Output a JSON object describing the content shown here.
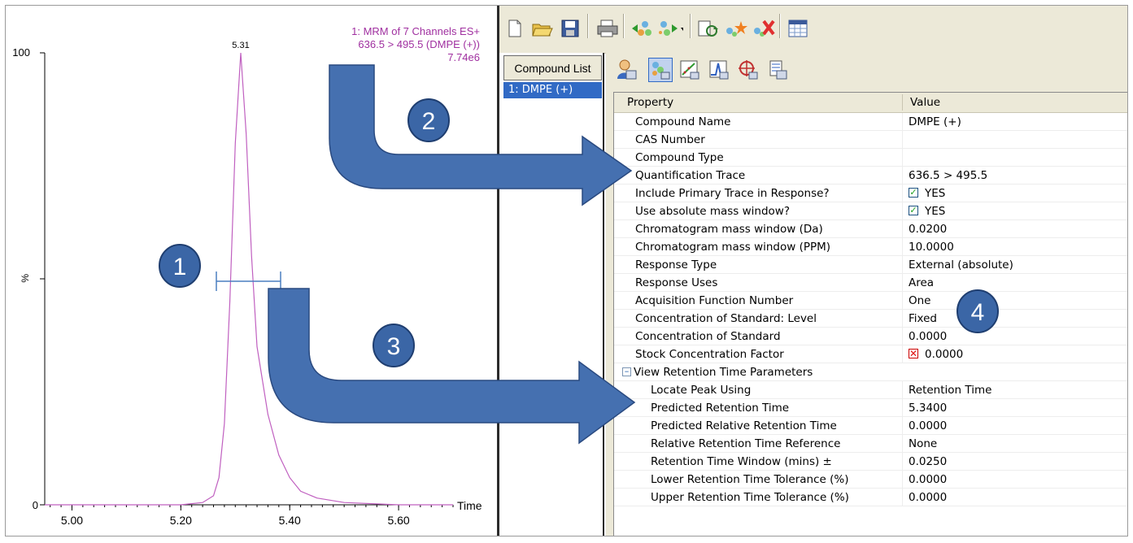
{
  "chart": {
    "header_line1": "1: MRM of 7 Channels ES+",
    "header_line2": "636.5 > 495.5 (DMPE (+))",
    "header_line3": "7.74e6",
    "peak_label": "5.31",
    "y_axis_top": "100",
    "y_axis_mid": "%",
    "y_axis_zero": "0",
    "x_axis_label": "Time",
    "x_ticks": [
      "5.00",
      "5.20",
      "5.40",
      "5.60"
    ],
    "line_color": "#c060c0",
    "header_color": "#a030a0"
  },
  "chart_data": {
    "type": "line",
    "x_ticks": [
      5.0,
      5.2,
      5.4,
      5.6
    ],
    "xlim": [
      4.95,
      5.7
    ],
    "ylim": [
      0,
      100
    ],
    "xlabel": "Time",
    "ylabel": "%",
    "series": [
      {
        "x": [
          4.95,
          5.2,
          5.24,
          5.26,
          5.27,
          5.28,
          5.29,
          5.3,
          5.31,
          5.32,
          5.33,
          5.34,
          5.36,
          5.38,
          5.4,
          5.42,
          5.45,
          5.5,
          5.6,
          5.7
        ],
        "values": [
          0,
          0,
          0.5,
          2,
          6,
          18,
          45,
          80,
          100,
          82,
          55,
          35,
          20,
          11,
          6,
          3,
          1.5,
          0.5,
          0,
          0
        ]
      }
    ],
    "peak_label": "5.31",
    "intensity": "7.74e6"
  },
  "toolbar": {
    "icons": [
      "new-file-icon",
      "open-folder-icon",
      "save-icon",
      "print-icon",
      "move-left-icon",
      "move-right-icon",
      "process-icon",
      "add-compound-icon",
      "remove-compound-icon",
      "table-icon"
    ]
  },
  "compound_list": {
    "header": "Compound List",
    "items": [
      "1: DMPE (+)"
    ]
  },
  "property_toolbar": {
    "icons": [
      "user-icon",
      "compound-props-icon",
      "calibration-icon",
      "peak-icon",
      "target-icon",
      "report-icon"
    ]
  },
  "grid": {
    "col_property": "Property",
    "col_value": "Value",
    "rows": [
      {
        "prop": "Compound Name",
        "val": "DMPE (+)"
      },
      {
        "prop": "CAS Number",
        "val": ""
      },
      {
        "prop": "Compound Type",
        "val": ""
      },
      {
        "prop": "Quantification Trace",
        "val": "636.5 > 495.5"
      },
      {
        "prop": "Include Primary Trace in Response?",
        "val": "YES",
        "check": "checked"
      },
      {
        "prop": "Use absolute mass window?",
        "val": "YES",
        "check": "checked"
      },
      {
        "prop": "Chromatogram mass window (Da)",
        "val": "0.0200"
      },
      {
        "prop": "Chromatogram mass window (PPM)",
        "val": "10.0000"
      },
      {
        "prop": "Response Type",
        "val": "External (absolute)"
      },
      {
        "prop": "Response Uses",
        "val": "Area"
      },
      {
        "prop": "Acquisition Function Number",
        "val": "One"
      },
      {
        "prop": "Concentration of Standard: Level",
        "val": "Fixed"
      },
      {
        "prop": "Concentration of Standard",
        "val": "0.0000"
      },
      {
        "prop": "Stock Concentration Factor",
        "val": "0.0000",
        "check": "x"
      }
    ],
    "section_label": "View Retention Time Parameters",
    "sub_rows": [
      {
        "prop": "Locate Peak Using",
        "val": "Retention Time"
      },
      {
        "prop": "Predicted Retention Time",
        "val": "5.3400"
      },
      {
        "prop": "Predicted Relative Retention Time",
        "val": "0.0000"
      },
      {
        "prop": "Relative Retention Time Reference",
        "val": "None"
      },
      {
        "prop": "Retention Time Window (mins) ±",
        "val": "0.0250"
      },
      {
        "prop": "Lower Retention Time Tolerance (%)",
        "val": "0.0000"
      },
      {
        "prop": "Upper Retention Time Tolerance (%)",
        "val": "0.0000"
      }
    ]
  },
  "annotations": {
    "callout_1": "1",
    "callout_2": "2",
    "callout_3": "3",
    "callout_4": "4",
    "callout_color": "#3b66a6",
    "arrow_color": "#4570b0"
  }
}
